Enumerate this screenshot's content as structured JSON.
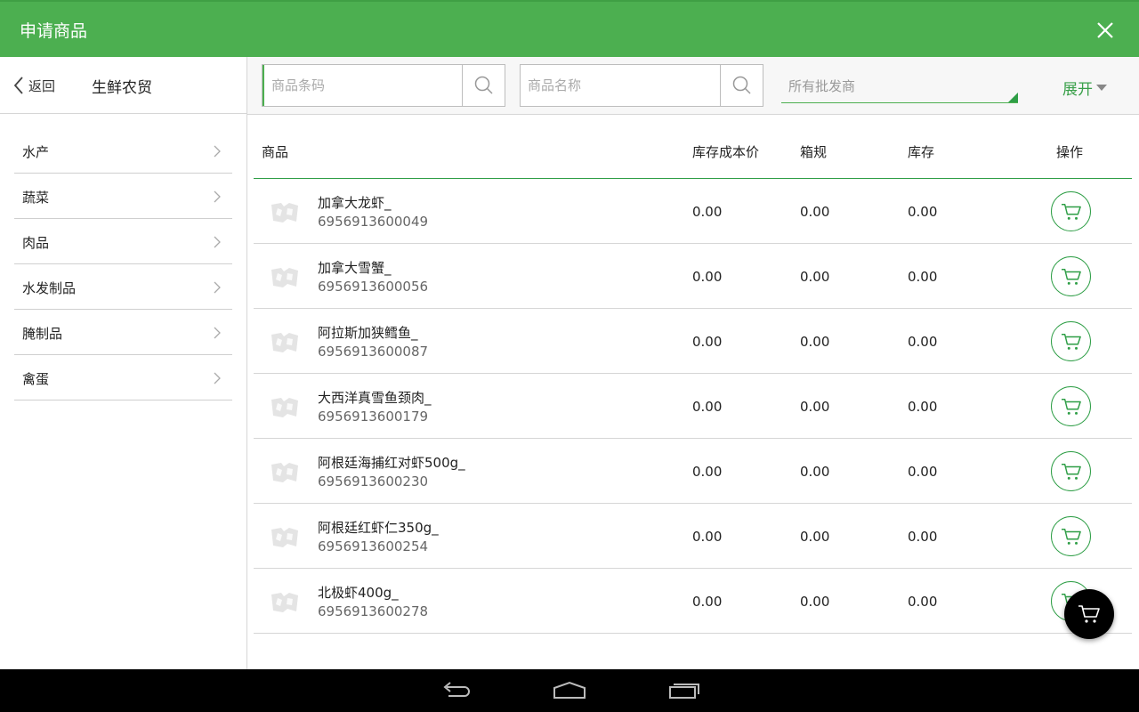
{
  "titlebar": {
    "title": "申请商品"
  },
  "sidebar": {
    "back_label": "返回",
    "title": "生鲜农贸",
    "categories": [
      {
        "label": "水产"
      },
      {
        "label": "蔬菜"
      },
      {
        "label": "肉品"
      },
      {
        "label": "水发制品"
      },
      {
        "label": "腌制品"
      },
      {
        "label": "禽蛋"
      }
    ]
  },
  "search": {
    "barcode_placeholder": "商品条码",
    "name_placeholder": "商品名称",
    "wholesaler_label": "所有批发商",
    "expand_label": "展开"
  },
  "table": {
    "headers": {
      "product": "商品",
      "cost": "库存成本价",
      "spec": "箱规",
      "stock": "库存",
      "action": "操作"
    },
    "rows": [
      {
        "name": "加拿大龙虾_",
        "code": "6956913600049",
        "cost": "0.00",
        "spec": "0.00",
        "stock": "0.00"
      },
      {
        "name": "加拿大雪蟹_",
        "code": "6956913600056",
        "cost": "0.00",
        "spec": "0.00",
        "stock": "0.00"
      },
      {
        "name": "阿拉斯加狭鳕鱼_",
        "code": "6956913600087",
        "cost": "0.00",
        "spec": "0.00",
        "stock": "0.00"
      },
      {
        "name": "大西洋真雪鱼颈肉_",
        "code": "6956913600179",
        "cost": "0.00",
        "spec": "0.00",
        "stock": "0.00"
      },
      {
        "name": "阿根廷海捕红对虾500g_",
        "code": "6956913600230",
        "cost": "0.00",
        "spec": "0.00",
        "stock": "0.00"
      },
      {
        "name": "阿根廷红虾仁350g_",
        "code": "6956913600254",
        "cost": "0.00",
        "spec": "0.00",
        "stock": "0.00"
      },
      {
        "name": "北极虾400g_",
        "code": "6956913600278",
        "cost": "0.00",
        "spec": "0.00",
        "stock": "0.00"
      }
    ]
  },
  "colors": {
    "accent": "#4caf50",
    "accent_dark": "#2e9e46",
    "navbar": "#000000"
  },
  "icons": {
    "close": "close-icon",
    "back": "chevron-left-icon",
    "search": "search-icon",
    "cart": "cart-icon",
    "thumb": "image-placeholder-icon"
  }
}
